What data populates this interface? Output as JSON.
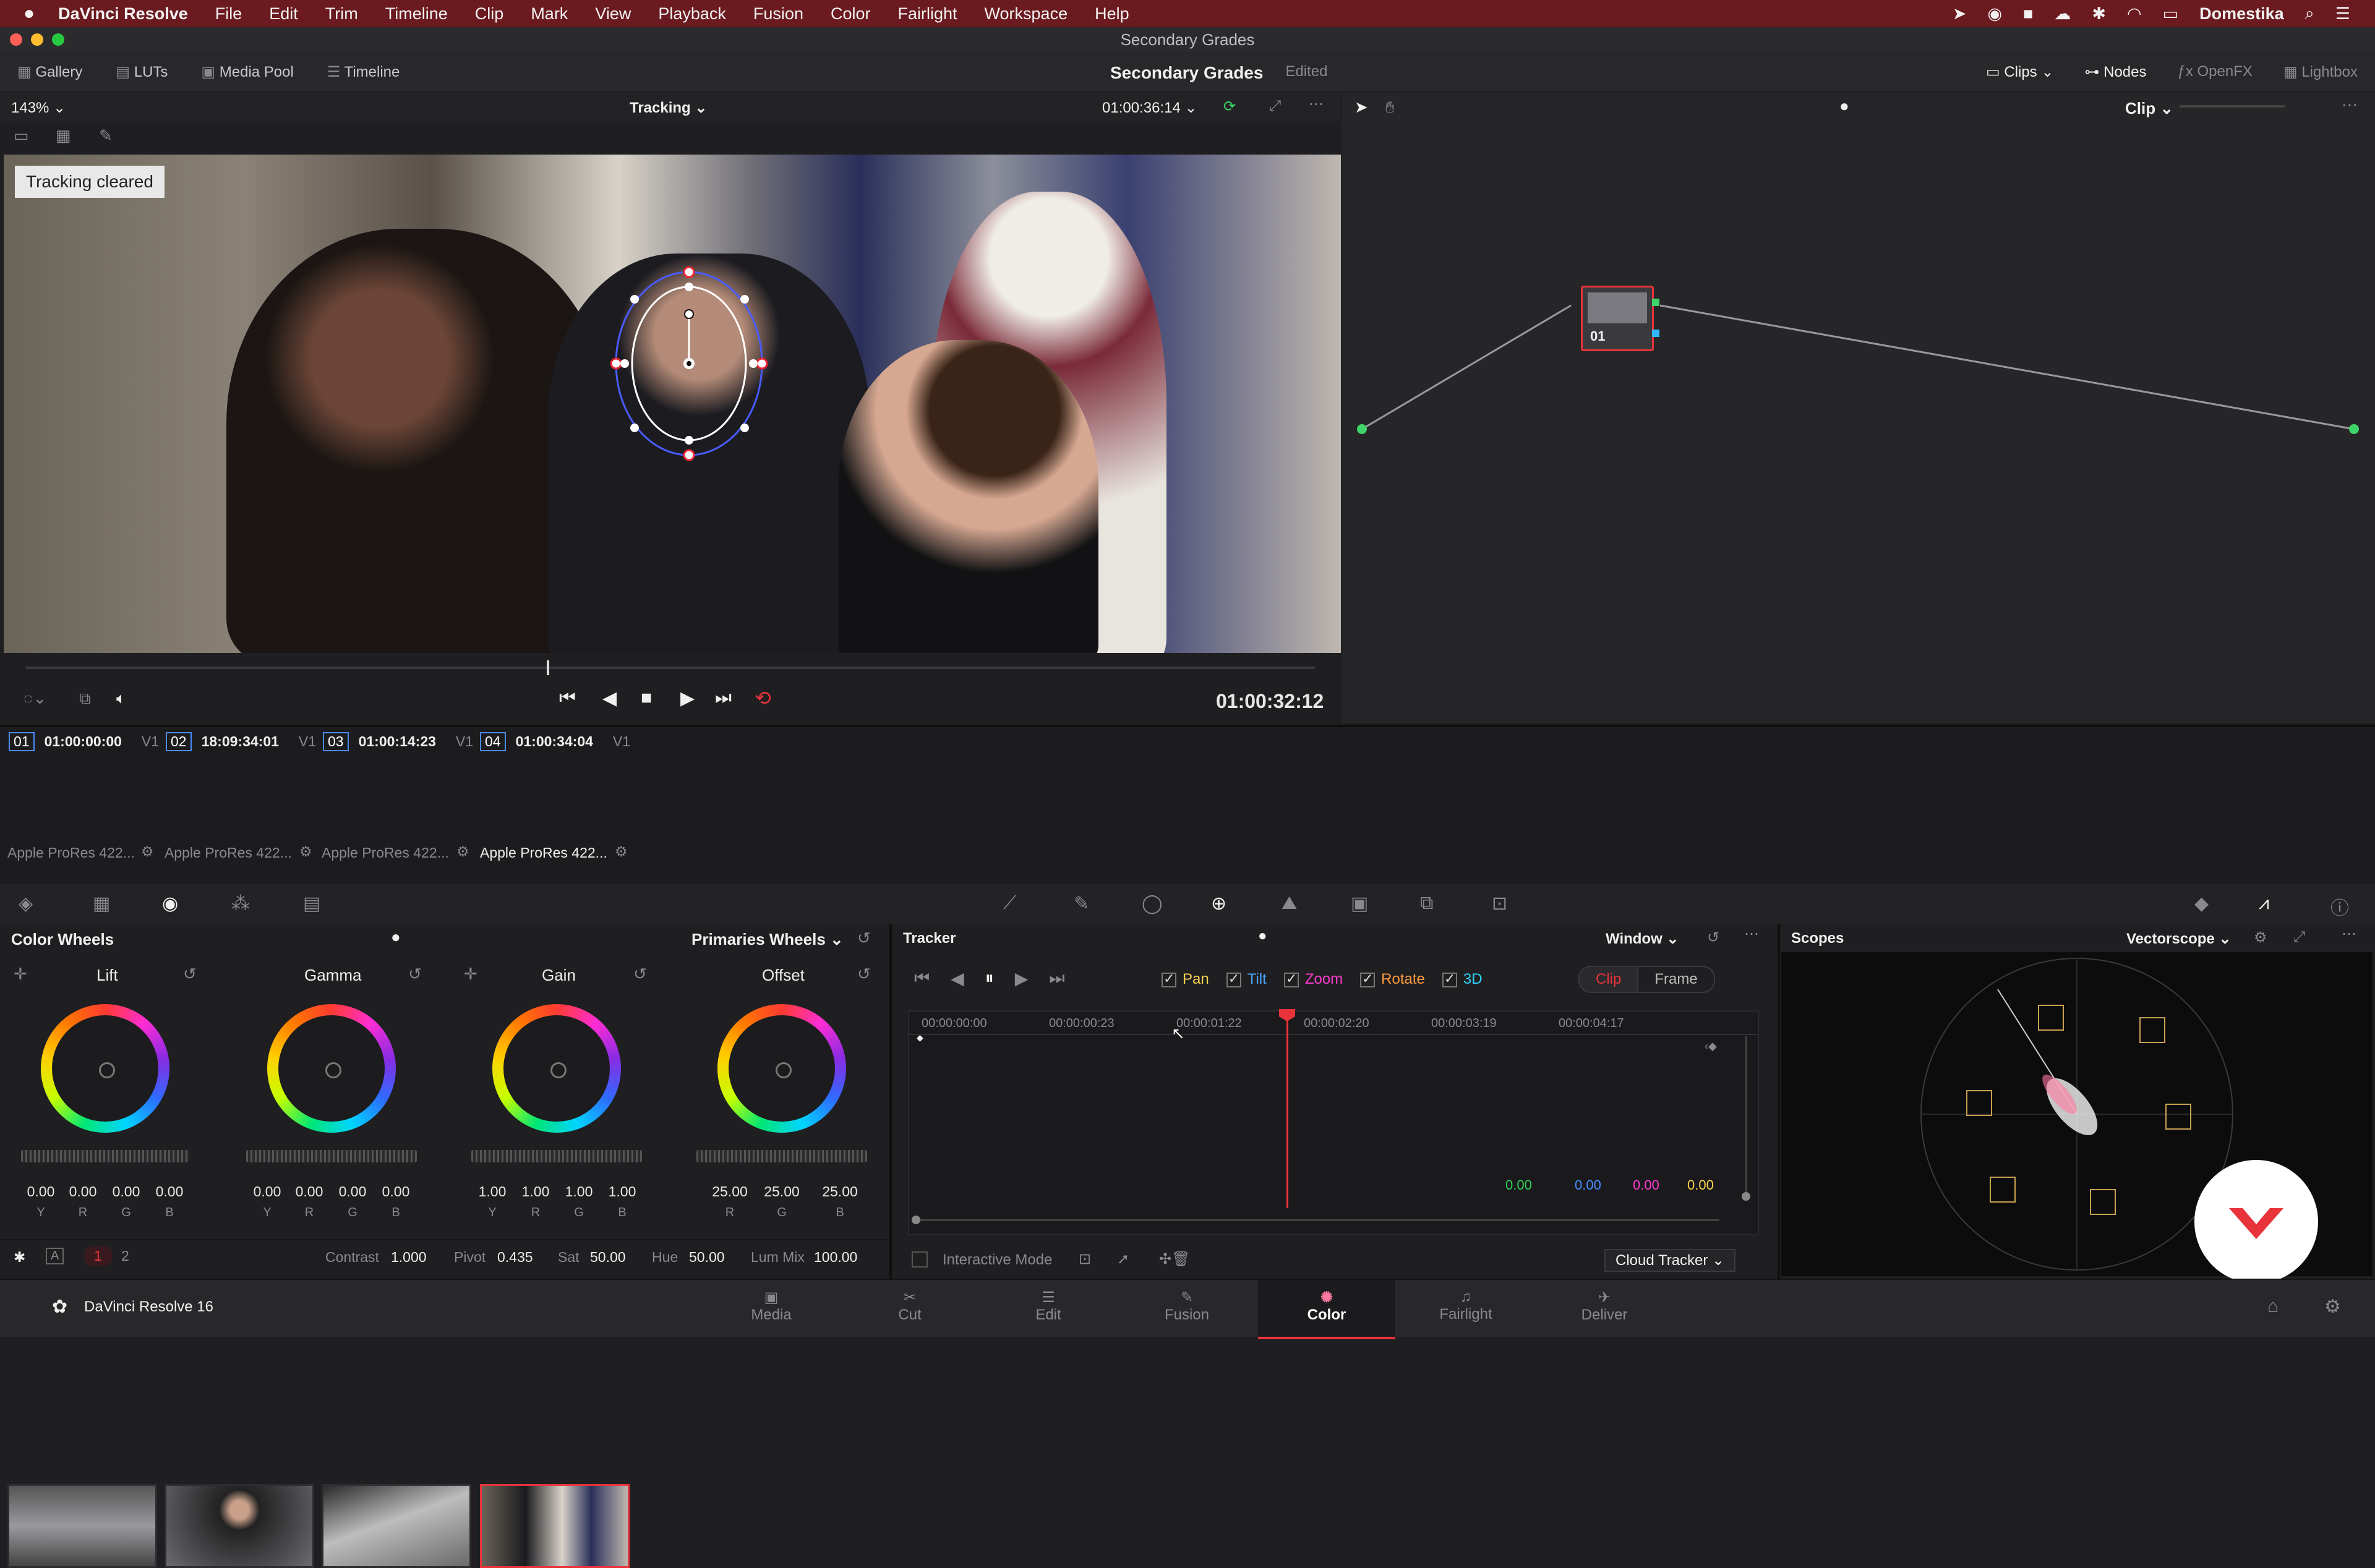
{
  "menubar": {
    "app": "DaVinci Resolve",
    "items": [
      "File",
      "Edit",
      "Trim",
      "Timeline",
      "Clip",
      "Mark",
      "View",
      "Playback",
      "Fusion",
      "Color",
      "Fairlight",
      "Workspace",
      "Help"
    ],
    "right_label": "Domestika"
  },
  "window": {
    "title": "Secondary Grades"
  },
  "toolbar": {
    "gallery": "Gallery",
    "luts": "LUTs",
    "media_pool": "Media Pool",
    "timeline": "Timeline",
    "project_title": "Secondary Grades",
    "edited": "Edited",
    "clips": "Clips",
    "nodes": "Nodes",
    "openfx": "OpenFX",
    "lightbox": "Lightbox"
  },
  "viewer": {
    "zoom": "143%",
    "mode": "Tracking",
    "timecode_top": "01:00:36:14",
    "overlay_msg": "Tracking cleared",
    "timecode_bottom": "01:00:32:12"
  },
  "node_editor": {
    "clip_mode": "Clip",
    "node_label": "01"
  },
  "clips": [
    {
      "num": "01",
      "tc": "01:00:00:00",
      "track": "V1",
      "name": "Apple ProRes 422..."
    },
    {
      "num": "02",
      "tc": "18:09:34:01",
      "track": "V1",
      "name": "Apple ProRes 422..."
    },
    {
      "num": "03",
      "tc": "01:00:14:23",
      "track": "V1",
      "name": "Apple ProRes 422..."
    },
    {
      "num": "04",
      "tc": "01:00:34:04",
      "track": "V1",
      "name": "Apple ProRes 422..."
    }
  ],
  "color_wheels": {
    "title": "Color Wheels",
    "mode": "Primaries Wheels",
    "wheels": [
      {
        "name": "Lift",
        "values": [
          "0.00",
          "0.00",
          "0.00",
          "0.00"
        ],
        "channels": [
          "Y",
          "R",
          "G",
          "B"
        ]
      },
      {
        "name": "Gamma",
        "values": [
          "0.00",
          "0.00",
          "0.00",
          "0.00"
        ],
        "channels": [
          "Y",
          "R",
          "G",
          "B"
        ]
      },
      {
        "name": "Gain",
        "values": [
          "1.00",
          "1.00",
          "1.00",
          "1.00"
        ],
        "channels": [
          "Y",
          "R",
          "G",
          "B"
        ]
      },
      {
        "name": "Offset",
        "values": [
          "25.00",
          "25.00",
          "25.00"
        ],
        "channels": [
          "R",
          "G",
          "B"
        ]
      }
    ],
    "page1": "1",
    "page2": "2",
    "contrast_label": "Contrast",
    "contrast": "1.000",
    "pivot_label": "Pivot",
    "pivot": "0.435",
    "sat_label": "Sat",
    "sat": "50.00",
    "hue_label": "Hue",
    "hue": "50.00",
    "lummix_label": "Lum Mix",
    "lummix": "100.00"
  },
  "tracker": {
    "title": "Tracker",
    "window_mode": "Window",
    "checks": [
      {
        "label": "Pan",
        "color": "#ffd54a"
      },
      {
        "label": "Tilt",
        "color": "#4aa8ff"
      },
      {
        "label": "Zoom",
        "color": "#ff3bd0"
      },
      {
        "label": "Rotate",
        "color": "#ff9a3c"
      },
      {
        "label": "3D",
        "color": "#2fd6ff"
      }
    ],
    "clip_tab": "Clip",
    "frame_tab": "Frame",
    "ruler": [
      "00:00:00:00",
      "00:00:00:23",
      "00:00:01:22",
      "00:00:02:20",
      "00:00:03:19",
      "00:00:04:17"
    ],
    "values": [
      {
        "v": "0.00",
        "color": "#31d158"
      },
      {
        "v": "0.00",
        "color": "#4a8cff"
      },
      {
        "v": "0.00",
        "color": "#ff3bd0"
      },
      {
        "v": "0.00",
        "color": "#ffd54a"
      }
    ],
    "interactive_mode": "Interactive Mode",
    "cloud_tracker": "Cloud Tracker"
  },
  "scopes": {
    "title": "Scopes",
    "mode": "Vectorscope"
  },
  "bottom_nav": {
    "app_version": "DaVinci Resolve 16",
    "pages": [
      "Media",
      "Cut",
      "Edit",
      "Fusion",
      "Color",
      "Fairlight",
      "Deliver"
    ],
    "active": "Color"
  },
  "colors": {
    "accent_red": "#e8333b",
    "menubar": "#6b1a1f",
    "panel": "#1f1f22"
  }
}
